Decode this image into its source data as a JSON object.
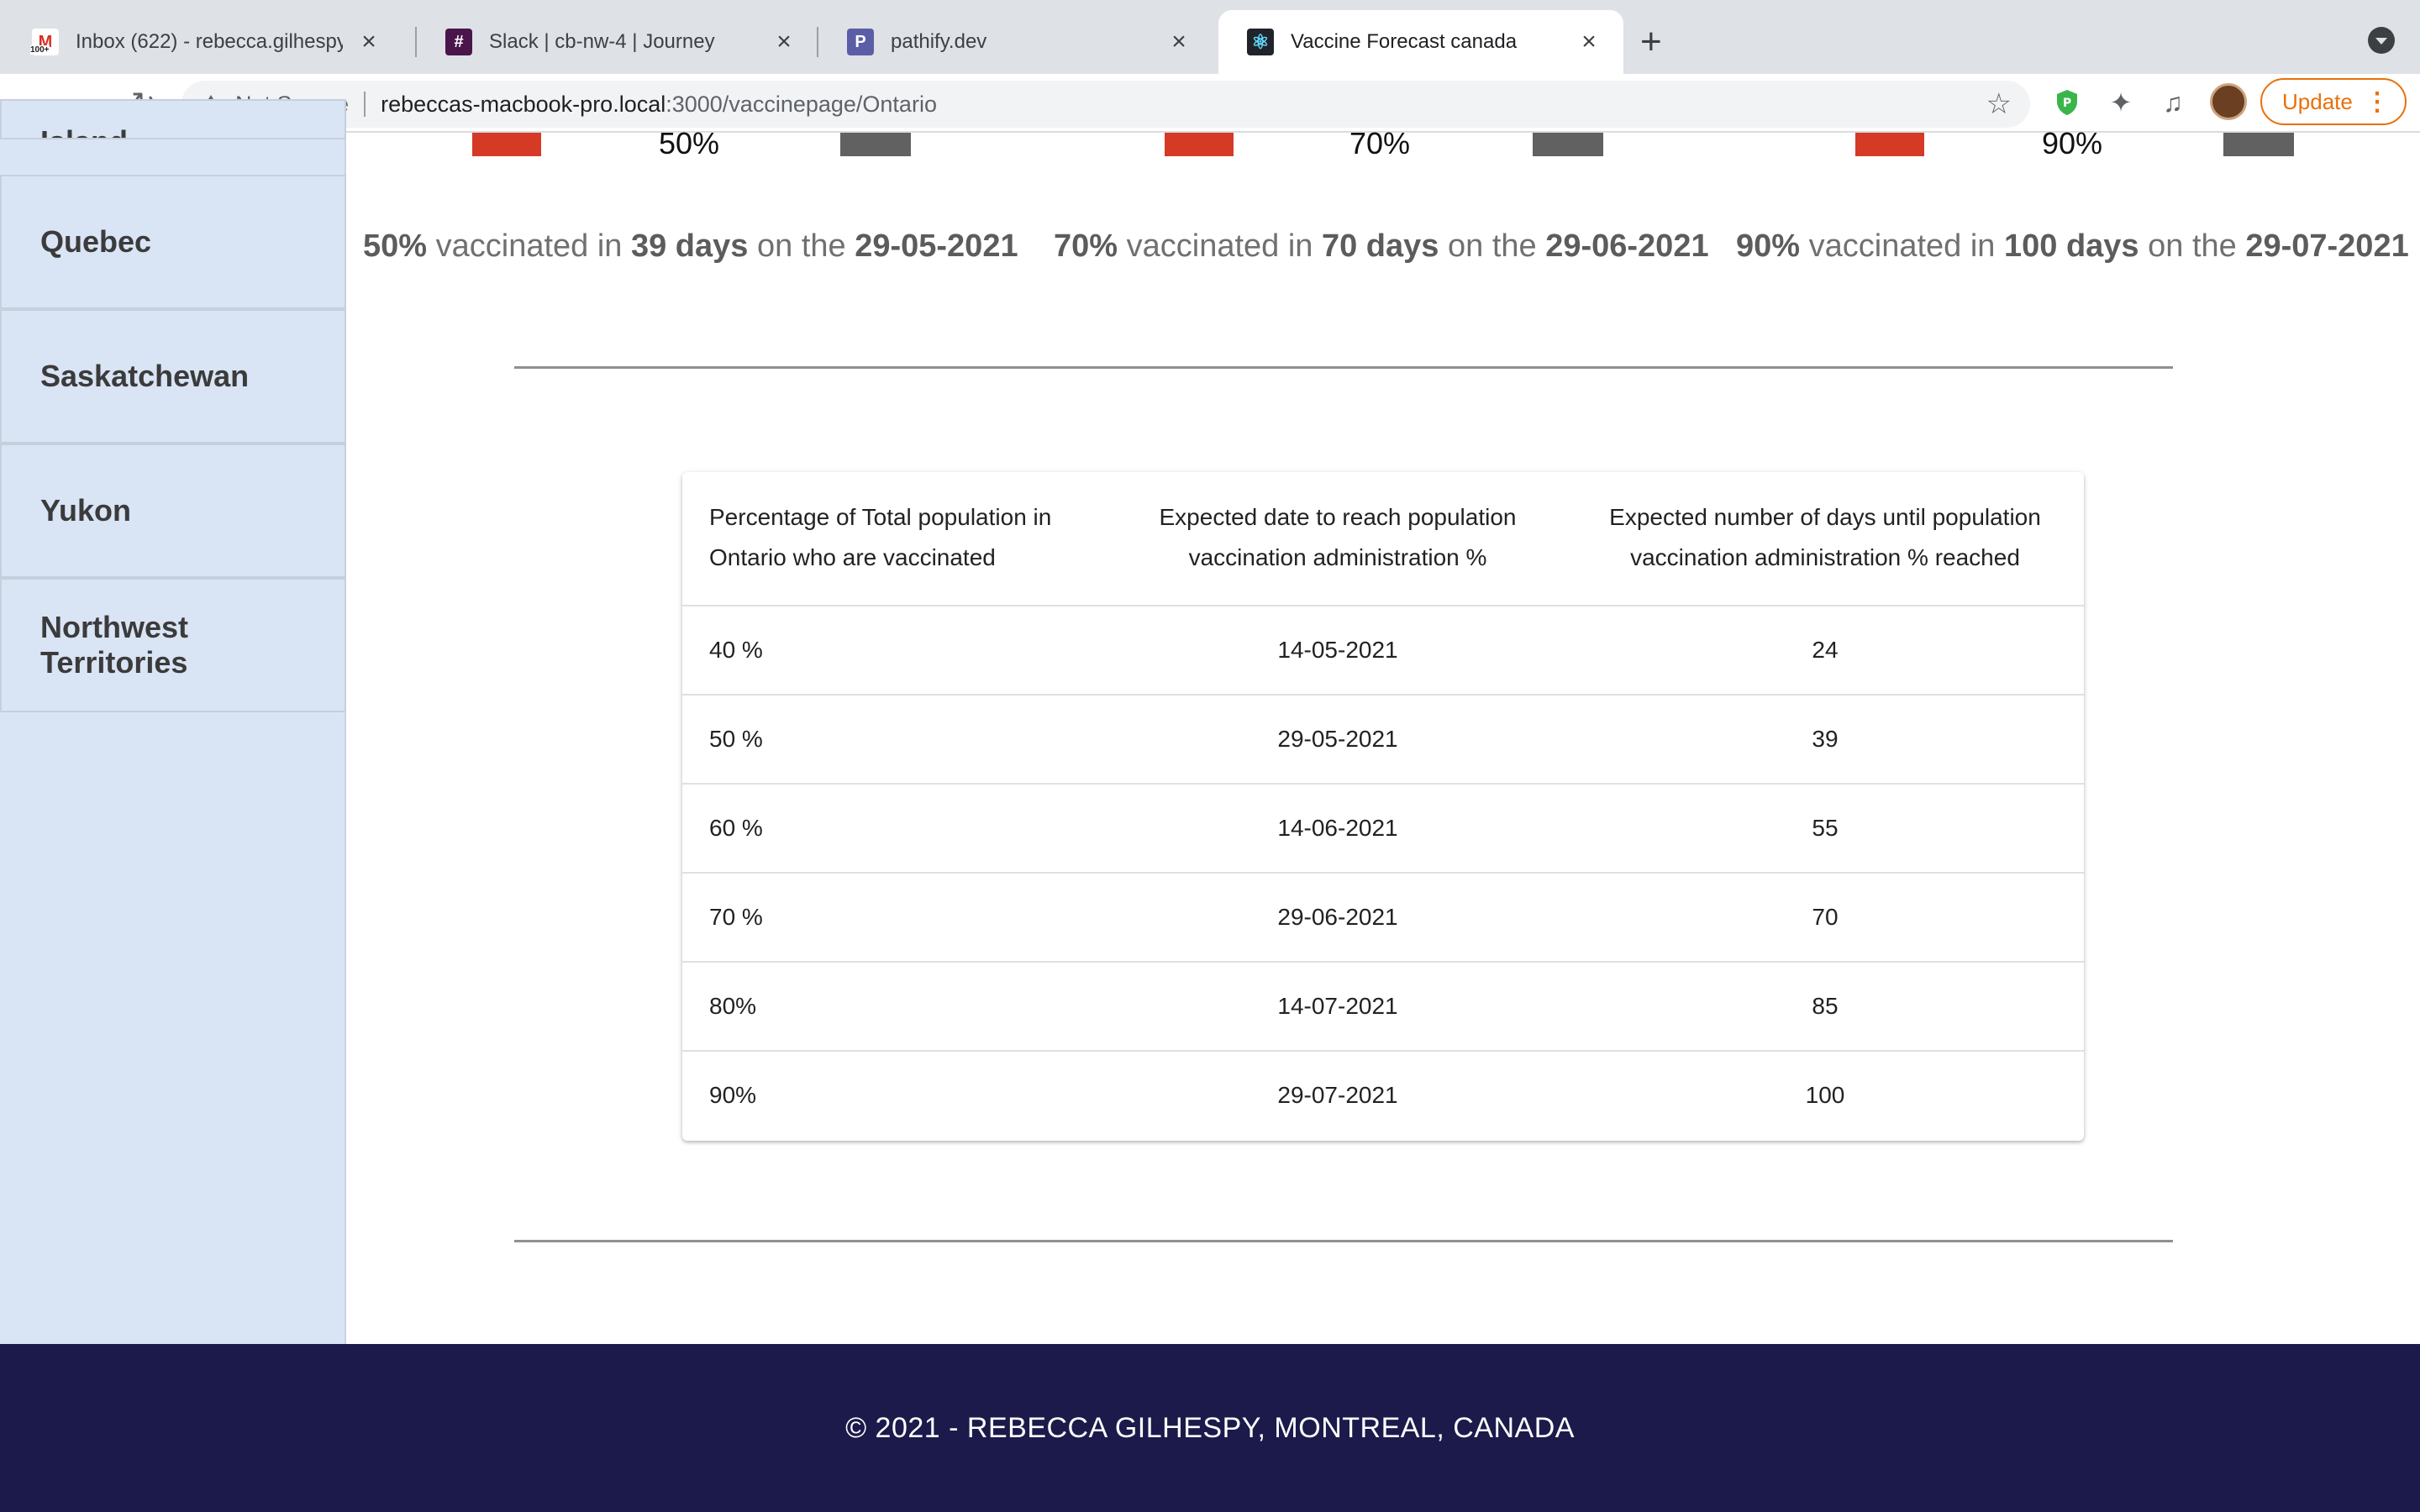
{
  "browser": {
    "tabs": [
      {
        "title": "Inbox (622) - rebecca.gilhespy",
        "favicon": "gmail-icon",
        "active": false
      },
      {
        "title": "Slack | cb-nw-4 | Journey",
        "favicon": "slack-icon",
        "active": false
      },
      {
        "title": "pathify.dev",
        "favicon": "pathify-icon",
        "active": false
      },
      {
        "title": "Vaccine Forecast canada",
        "favicon": "react-icon",
        "active": true
      }
    ],
    "gmail_badge": "100+",
    "security_label": "Not Secure",
    "url_host": "rebeccas-macbook-pro.local",
    "url_path": ":3000/vaccinepage/Ontario",
    "update_label": "Update",
    "icons": {
      "back": "←",
      "forward": "→",
      "reload": "↻",
      "new_tab": "+",
      "close": "×",
      "star": "☆",
      "extensions": "✦",
      "media": "♫",
      "menu": "⋮"
    }
  },
  "sidebar": {
    "items": [
      {
        "label": "Island"
      },
      {
        "label": "Quebec"
      },
      {
        "label": "Saskatchewan"
      },
      {
        "label": "Yukon"
      },
      {
        "label": "Northwest Territories"
      }
    ]
  },
  "progress_bars": [
    {
      "percent_label": "50%"
    },
    {
      "percent_label": "70%"
    },
    {
      "percent_label": "90%"
    }
  ],
  "summaries": [
    {
      "percent": "50%",
      "text1": " vaccinated in ",
      "days": "39 days",
      "text2": " on the ",
      "date": "29-05-2021"
    },
    {
      "percent": "70%",
      "text1": " vaccinated in ",
      "days": "70 days",
      "text2": " on the ",
      "date": "29-06-2021"
    },
    {
      "percent": "90%",
      "text1": " vaccinated in ",
      "days": "100 days",
      "text2": " on the ",
      "date": "29-07-2021"
    }
  ],
  "table": {
    "headers": [
      [
        "Percentage of Total population in",
        "Ontario who are vaccinated"
      ],
      [
        "Expected date to reach population",
        "vaccination administration %"
      ],
      [
        "Expected number of days until population",
        "vaccination administration % reached"
      ]
    ],
    "rows": [
      {
        "pct": "40 %",
        "date": "14-05-2021",
        "days": "24"
      },
      {
        "pct": "50 %",
        "date": "29-05-2021",
        "days": "39"
      },
      {
        "pct": "60 %",
        "date": "14-06-2021",
        "days": "55"
      },
      {
        "pct": "70 %",
        "date": "29-06-2021",
        "days": "70"
      },
      {
        "pct": "80%",
        "date": "14-07-2021",
        "days": "85"
      },
      {
        "pct": "90%",
        "date": "29-07-2021",
        "days": "100"
      }
    ]
  },
  "footer": {
    "text": "© 2021 - REBECCA GILHESPY, MONTREAL, CANADA"
  },
  "colors": {
    "sidebar_bg": "#d9e4f5",
    "bar_red": "#d43a26",
    "bar_grey": "#616161",
    "footer_bg": "#1b1a4a",
    "update_accent": "#e8710a"
  }
}
